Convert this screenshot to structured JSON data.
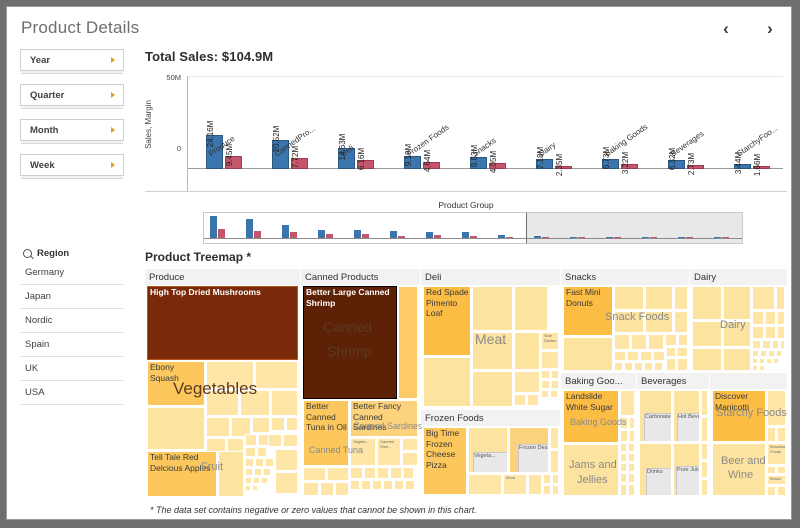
{
  "header": {
    "title": "Product Details",
    "prev_icon": "chevron-left-icon",
    "prev_label": "‹",
    "next_icon": "chevron-right-icon",
    "next_label": "›"
  },
  "filters": {
    "buttons": [
      {
        "label": "Year"
      },
      {
        "label": "Quarter"
      },
      {
        "label": "Month"
      },
      {
        "label": "Week"
      }
    ]
  },
  "region": {
    "search_icon": "search-icon",
    "title": "Region",
    "items": [
      {
        "label": "Germany"
      },
      {
        "label": "Japan"
      },
      {
        "label": "Nordic"
      },
      {
        "label": "Spain"
      },
      {
        "label": "UK"
      },
      {
        "label": "USA"
      }
    ]
  },
  "main": {
    "total_sales": "Total Sales: $104.9M",
    "treemap_title": "Product Treemap *",
    "footnote": "* The data set contains negative or zero values that cannot be shown in this chart."
  },
  "colors": {
    "sales_blue": "#3b75ad",
    "margin_red": "#c4566c",
    "treemap_dark": "#7a2a08",
    "treemap_darkest": "#5d2105",
    "treemap_mid": "#f7b541",
    "treemap_light": "#fde39a",
    "accent_caret": "#e09a2b"
  },
  "chart_data": {
    "type": "bar",
    "title": "Total Sales: $104.9M",
    "xlabel": "Product Group",
    "ylabel": "Sales, Margin",
    "ylim": [
      0,
      50000000
    ],
    "yticks": [
      "0",
      "50M"
    ],
    "grid": false,
    "legend": [
      "Sales",
      "Margin"
    ],
    "categories": [
      "Produce",
      "CannedPro...",
      "Deli",
      "Frozen Foods",
      "Snacks",
      "Dairy",
      "Baking Goods",
      "Beverages",
      "StarchyFoo..."
    ],
    "series": [
      {
        "name": "Sales",
        "color": "#3b75ad",
        "values": [
          24.16,
          20.52,
          14.63,
          9.19,
          8.63,
          7.18,
          6.73,
          6.32,
          3.44
        ],
        "labels": [
          "24.16M",
          "20.52M",
          "14.63M",
          "9.19M",
          "8.63M",
          "7.18M",
          "6.73M",
          "6.32M",
          "3.44M"
        ]
      },
      {
        "name": "Margin",
        "color": "#c4566c",
        "values": [
          9.45,
          7.72,
          6.16,
          4.64,
          4.05,
          2.35,
          3.22,
          2.73,
          1.66
        ],
        "labels": [
          "9.45M",
          "7.72M",
          "6.16M",
          "4.64M",
          "4.05M",
          "2.35M",
          "3.22M",
          "2.73M",
          "1.66M"
        ]
      }
    ]
  },
  "treemap": {
    "note": "Product Treemap *",
    "groups": [
      {
        "header": "Produce",
        "overlay": "Vegetables",
        "tiles": [
          {
            "label": "High Top Dried Mushrooms"
          },
          {
            "label": "Ebony Squash"
          },
          {
            "label": "Tell Tale Red Delcious Apples"
          },
          {
            "label": "Fruit"
          }
        ]
      },
      {
        "header": "Canned Products",
        "overlay": "Canned Shrimp",
        "tiles": [
          {
            "label": "Better Large Canned Shrimp"
          },
          {
            "label": "Better Canned Tuna in Oil"
          },
          {
            "label": "Canned Tuna"
          },
          {
            "label": "Better Fancy Canned Sardines"
          },
          {
            "label": "Canned Sardines"
          },
          {
            "label": "Vegeta..."
          },
          {
            "label": "Canned Shel..."
          }
        ]
      },
      {
        "header": "Deli",
        "overlay": "Meat",
        "tiles": [
          {
            "label": "Red Spade Pimento Loaf"
          },
          {
            "label": "Side Dishes"
          }
        ]
      },
      {
        "header": "Frozen Foods",
        "overlay": "",
        "tiles": [
          {
            "label": "Big Time Frozen Cheese Pizza"
          },
          {
            "label": "Vegeta..."
          },
          {
            "label": "Frozen Desserts"
          },
          {
            "label": "Meat"
          }
        ]
      },
      {
        "header": "Snacks",
        "overlay": "Snack Foods",
        "tiles": [
          {
            "label": "Fast Mini Donuts"
          },
          {
            "label": "..."
          }
        ]
      },
      {
        "header": "Dairy",
        "overlay": "Dairy",
        "tiles": []
      },
      {
        "header": "Baking Goo...",
        "overlay": "Baking Goods",
        "tiles": [
          {
            "label": "Landslide White Sugar"
          },
          {
            "label": "Jams and Jellies"
          }
        ]
      },
      {
        "header": "Beverages",
        "overlay": "",
        "tiles": [
          {
            "label": "Carbonated Be..."
          },
          {
            "label": "Hot Bever..."
          },
          {
            "label": "Drinks"
          },
          {
            "label": "Pure Juice B..."
          }
        ]
      },
      {
        "header": "",
        "overlay": "Starchy Foods",
        "tiles": [
          {
            "label": "Discover Manicotti"
          },
          {
            "label": "Beer and Wine"
          },
          {
            "label": "Breakfast Foods"
          },
          {
            "label": "Bread"
          }
        ]
      }
    ]
  }
}
